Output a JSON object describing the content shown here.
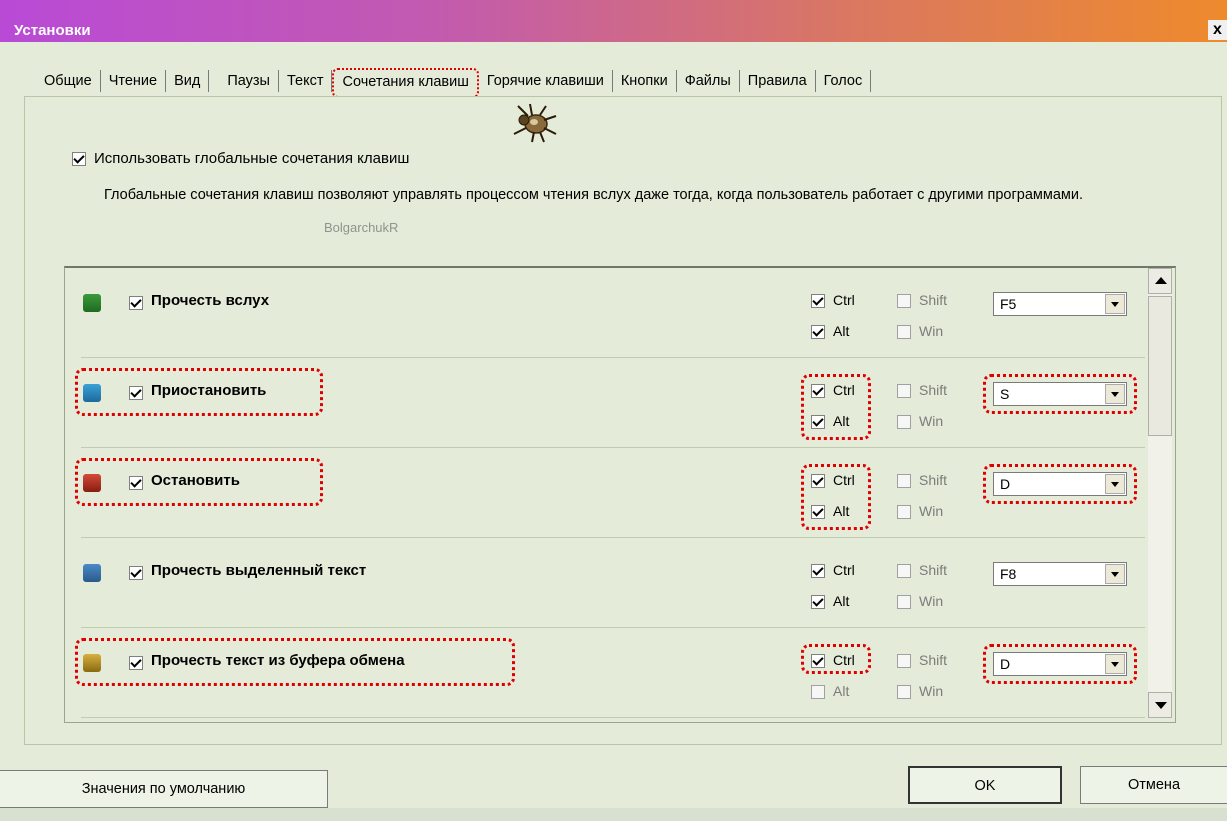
{
  "window": {
    "title": "Установки",
    "close": "x"
  },
  "tabs": [
    {
      "label": "Общие"
    },
    {
      "label": "Чтение"
    },
    {
      "label": "Вид"
    },
    {
      "label": "Паузы"
    },
    {
      "label": "Текст"
    },
    {
      "label": "Сочетания клавиш"
    },
    {
      "label": "Горячие клавиши"
    },
    {
      "label": "Кнопки"
    },
    {
      "label": "Файлы"
    },
    {
      "label": "Правила"
    },
    {
      "label": "Голос"
    }
  ],
  "active_tab": "Сочетания клавиш",
  "global": {
    "checkbox_label": "Использовать глобальные сочетания клавиш",
    "checked": true,
    "description": "Глобальные сочетания клавиш позволяют управлять процессом чтения вслух даже тогда, когда пользователь работает с другими программами.",
    "watermark": "BolgarchukR"
  },
  "modifiers": {
    "ctrl": "Ctrl",
    "alt": "Alt",
    "shift": "Shift",
    "win": "Win"
  },
  "actions": [
    {
      "label": "Прочесть вслух",
      "icon": "play-icon",
      "checked": true,
      "ctrl": true,
      "alt": true,
      "shift": false,
      "win": false,
      "key": "F5",
      "highlighted": false
    },
    {
      "label": "Приостановить",
      "icon": "pause-icon",
      "checked": true,
      "ctrl": true,
      "alt": true,
      "shift": false,
      "win": false,
      "key": "S",
      "highlighted": true
    },
    {
      "label": "Остановить",
      "icon": "stop-icon",
      "checked": true,
      "ctrl": true,
      "alt": true,
      "shift": false,
      "win": false,
      "key": "D",
      "highlighted": true
    },
    {
      "label": "Прочесть выделенный текст",
      "icon": "read-selection-icon",
      "checked": true,
      "ctrl": true,
      "alt": true,
      "shift": false,
      "win": false,
      "key": "F8",
      "highlighted": false
    },
    {
      "label": "Прочесть текст из буфера обмена",
      "icon": "clipboard-icon",
      "checked": true,
      "ctrl": true,
      "alt": false,
      "shift": false,
      "win": false,
      "key": "D",
      "highlighted": true
    }
  ],
  "buttons": {
    "defaults": "Значения по умолчанию",
    "ok": "OK",
    "cancel": "Отмена"
  },
  "colors": {
    "accent_highlight": "#e00000",
    "panel_bg": "#e4ecd9"
  }
}
